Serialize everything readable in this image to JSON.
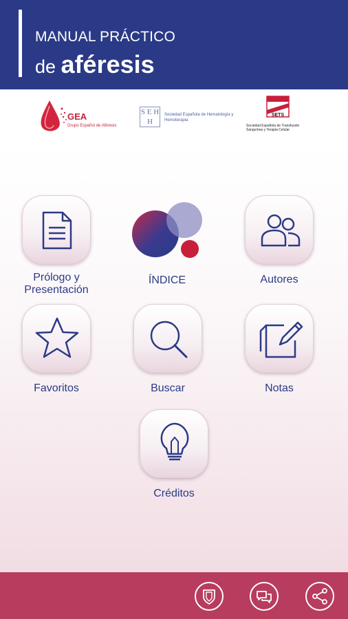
{
  "header": {
    "title_line1": "MANUAL PRÁCTICO",
    "title_pre": "de ",
    "title_bold": "aféresis",
    "background": "#2b3a86"
  },
  "logos": {
    "gea": {
      "name": "GEA",
      "subtitle": "Grupo Español de Aféresis"
    },
    "sehh": {
      "mark": "S E H H",
      "name": "Sociedad Española de Hematología y Hemoterapia"
    },
    "sets": {
      "name": "SETS",
      "subtitle": "Sociedad Española de Transfusión Sanguínea y Terapia Celular"
    }
  },
  "menu": {
    "prologo": "Prólogo y Presentación",
    "indice": "ÍNDICE",
    "autores": "Autores",
    "favoritos": "Favoritos",
    "buscar": "Buscar",
    "notas": "Notas",
    "creditos": "Créditos"
  },
  "colors": {
    "primary": "#2b3a86",
    "accent": "#b83c5d",
    "icon_stroke": "#2b3a86"
  },
  "footer": {
    "icons": [
      "shield-icon",
      "chat-icon",
      "share-icon"
    ]
  }
}
